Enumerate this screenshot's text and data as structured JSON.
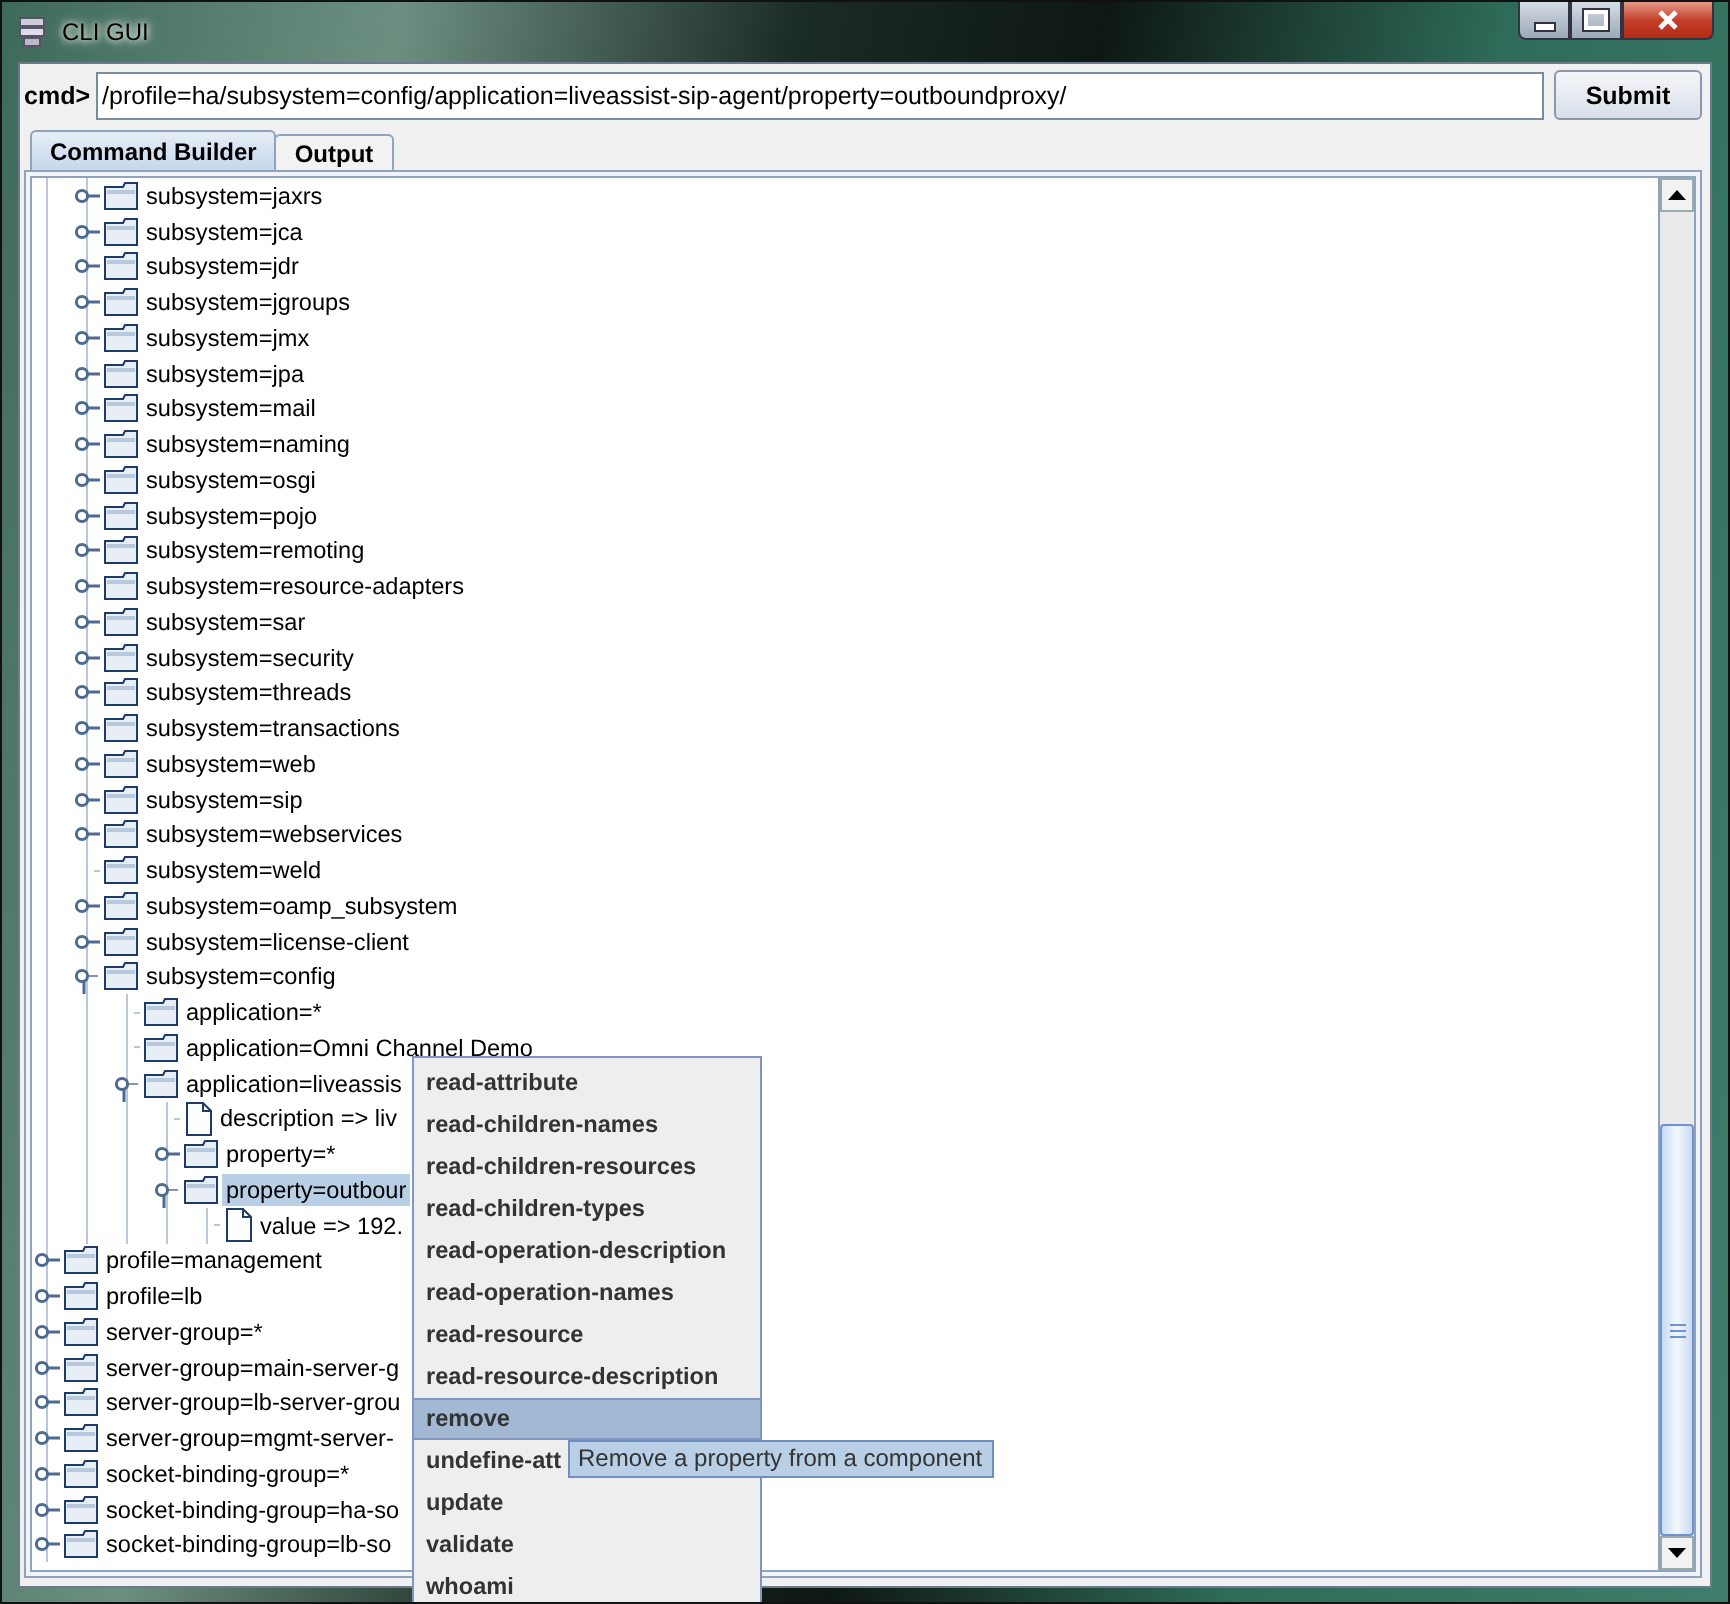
{
  "window": {
    "title": "CLI GUI"
  },
  "command": {
    "label": "cmd>",
    "value": "/profile=ha/subsystem=config/application=liveassist-sip-agent/property=outboundproxy/",
    "submit": "Submit"
  },
  "tabs": [
    {
      "label": "Command Builder",
      "selected": true
    },
    {
      "label": "Output",
      "selected": false
    }
  ],
  "tree": {
    "visible_branch": [
      {
        "label": "subsystem=jaxrs",
        "kind": "branch",
        "expanded": false
      },
      {
        "label": "subsystem=jca",
        "kind": "branch",
        "expanded": false
      },
      {
        "label": "subsystem=jdr",
        "kind": "branch",
        "expanded": false
      },
      {
        "label": "subsystem=jgroups",
        "kind": "branch",
        "expanded": false
      },
      {
        "label": "subsystem=jmx",
        "kind": "branch",
        "expanded": false
      },
      {
        "label": "subsystem=jpa",
        "kind": "branch",
        "expanded": false
      },
      {
        "label": "subsystem=mail",
        "kind": "branch",
        "expanded": false
      },
      {
        "label": "subsystem=naming",
        "kind": "branch",
        "expanded": false
      },
      {
        "label": "subsystem=osgi",
        "kind": "branch",
        "expanded": false
      },
      {
        "label": "subsystem=pojo",
        "kind": "branch",
        "expanded": false
      },
      {
        "label": "subsystem=remoting",
        "kind": "branch",
        "expanded": false
      },
      {
        "label": "subsystem=resource-adapters",
        "kind": "branch",
        "expanded": false
      },
      {
        "label": "subsystem=sar",
        "kind": "branch",
        "expanded": false
      },
      {
        "label": "subsystem=security",
        "kind": "branch",
        "expanded": false
      },
      {
        "label": "subsystem=threads",
        "kind": "branch",
        "expanded": false
      },
      {
        "label": "subsystem=transactions",
        "kind": "branch",
        "expanded": false
      },
      {
        "label": "subsystem=web",
        "kind": "branch",
        "expanded": false
      },
      {
        "label": "subsystem=sip",
        "kind": "branch",
        "expanded": false
      },
      {
        "label": "subsystem=webservices",
        "kind": "branch",
        "expanded": false
      },
      {
        "label": "subsystem=weld",
        "kind": "folder"
      },
      {
        "label": "subsystem=oamp_subsystem",
        "kind": "branch",
        "expanded": false
      },
      {
        "label": "subsystem=license-client",
        "kind": "branch",
        "expanded": false
      },
      {
        "label": "subsystem=config",
        "kind": "branch",
        "expanded": true,
        "children": [
          {
            "label": "application=*",
            "kind": "folder"
          },
          {
            "label": "application=Omni Channel Demo",
            "kind": "folder"
          },
          {
            "label": "application=liveassis",
            "kind": "branch",
            "expanded": true,
            "children": [
              {
                "label": "description => liv",
                "kind": "file"
              },
              {
                "label": "property=*",
                "kind": "branch",
                "expanded": false
              },
              {
                "label": "property=outbour",
                "kind": "branch",
                "expanded": true,
                "selected": true,
                "children": [
                  {
                    "label": "value => 192.",
                    "kind": "file"
                  }
                ]
              }
            ]
          }
        ]
      }
    ],
    "items": [
      {
        "label": "profile=management",
        "kind": "branch",
        "expanded": false
      },
      {
        "label": "profile=lb",
        "kind": "branch",
        "expanded": false
      },
      {
        "label": "server-group=*",
        "kind": "branch",
        "expanded": false
      },
      {
        "label": "server-group=main-server-g",
        "kind": "branch",
        "expanded": false
      },
      {
        "label": "server-group=lb-server-grou",
        "kind": "branch",
        "expanded": false
      },
      {
        "label": "server-group=mgmt-server-",
        "kind": "branch",
        "expanded": false
      },
      {
        "label": "socket-binding-group=*",
        "kind": "branch",
        "expanded": false
      },
      {
        "label": "socket-binding-group=ha-so",
        "kind": "branch",
        "expanded": false
      },
      {
        "label": "socket-binding-group=lb-so",
        "kind": "branch",
        "expanded": false
      }
    ]
  },
  "context_menu": {
    "items": [
      {
        "label": "read-attribute",
        "selected": false
      },
      {
        "label": "read-children-names",
        "selected": false
      },
      {
        "label": "read-children-resources",
        "selected": false
      },
      {
        "label": "read-children-types",
        "selected": false
      },
      {
        "label": "read-operation-description",
        "selected": false
      },
      {
        "label": "read-operation-names",
        "selected": false
      },
      {
        "label": "read-resource",
        "selected": false
      },
      {
        "label": "read-resource-description",
        "selected": false
      },
      {
        "label": "remove",
        "selected": true
      },
      {
        "label": "undefine-att",
        "selected": false
      },
      {
        "label": "update",
        "selected": false
      },
      {
        "label": "validate",
        "selected": false
      },
      {
        "label": "whoami",
        "selected": false
      }
    ]
  },
  "tooltip": "Remove a property from a component"
}
